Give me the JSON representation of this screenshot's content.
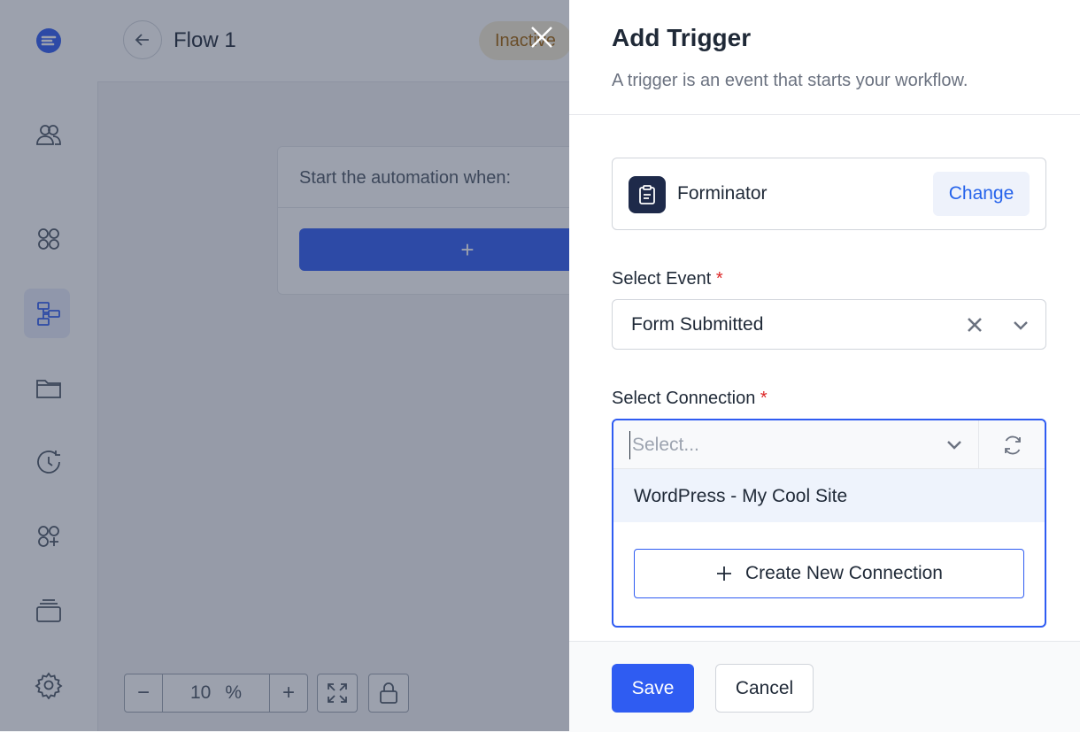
{
  "app": {
    "flow_title": "Flow 1",
    "status": "Inactive",
    "canvas_prompt": "Start the automation when:",
    "add_step_symbol": "+",
    "zoom": {
      "value": "10",
      "unit": "%",
      "minus": "−",
      "plus": "+"
    }
  },
  "sidebar": {
    "items": [
      {
        "icon": "logo-icon"
      },
      {
        "icon": "users-icon"
      },
      {
        "icon": "dashboard-icon"
      },
      {
        "icon": "workflows-icon",
        "active": true
      },
      {
        "icon": "folder-icon"
      },
      {
        "icon": "history-icon"
      },
      {
        "icon": "integrations-icon"
      },
      {
        "icon": "templates-icon"
      },
      {
        "icon": "gear-icon"
      }
    ]
  },
  "drawer": {
    "title": "Add Trigger",
    "subtitle": "A trigger is an event that starts your workflow.",
    "app_name": "Forminator",
    "change_label": "Change",
    "event_label": "Select Event",
    "event_value": "Form Submitted",
    "required_mark": "*",
    "connection_label": "Select Connection",
    "connection_placeholder": "Select...",
    "connection_option": "WordPress - My Cool Site",
    "create_connection_label": "Create New Connection",
    "save_label": "Save",
    "cancel_label": "Cancel"
  },
  "colors": {
    "primary": "#2f5cf2",
    "required": "#dc2626",
    "status_bg": "#f6ecd3",
    "status_text": "#a16207"
  }
}
